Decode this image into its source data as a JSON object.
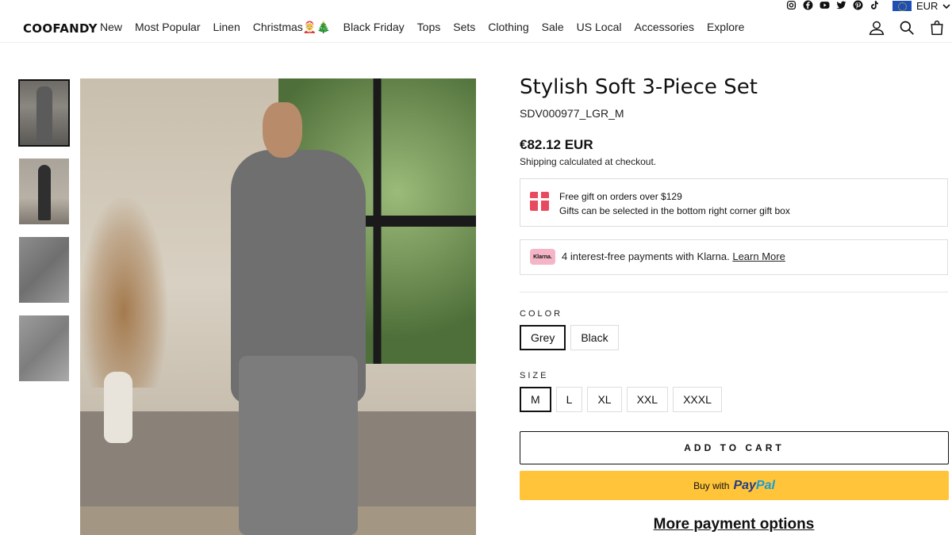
{
  "social": {
    "icons": [
      "instagram-icon",
      "facebook-icon",
      "youtube-icon",
      "twitter-icon",
      "pinterest-icon",
      "tiktok-icon"
    ]
  },
  "currency": {
    "code": "EUR",
    "flag": "eu-flag-icon"
  },
  "brand": {
    "logo": "COOFANDY"
  },
  "nav": {
    "items": [
      "New",
      "Most Popular",
      "Linen",
      "Christmas🤶🎄",
      "Black Friday",
      "Tops",
      "Sets",
      "Clothing",
      "Sale",
      "US Local",
      "Accessories",
      "Explore"
    ]
  },
  "product": {
    "title": "Stylish Soft 3-Piece Set",
    "sku": "SDV000977_LGR_M",
    "price": "€82.12 EUR",
    "shipping_note": "Shipping calculated at checkout."
  },
  "gift": {
    "line1": "Free gift on orders over $129",
    "line2": "Gifts can be selected in the bottom right corner gift box"
  },
  "klarna": {
    "logo": "Klarna.",
    "text": "4 interest-free payments with Klarna.",
    "link": "Learn More"
  },
  "color": {
    "label": "COLOR",
    "options": [
      "Grey",
      "Black"
    ],
    "selected": "Grey"
  },
  "size": {
    "label": "SIZE",
    "options": [
      "M",
      "L",
      "XL",
      "XXL",
      "XXXL"
    ],
    "selected": "M"
  },
  "actions": {
    "add_to_cart": "ADD TO CART",
    "paypal_prefix": "Buy with",
    "paypal_brand_a": "Pay",
    "paypal_brand_b": "Pal",
    "more_payment": "More payment options"
  },
  "colors": {
    "paypal_bg": "#ffc439",
    "klarna_pink": "#f4b6c7",
    "gift_red": "#e84a5f"
  }
}
